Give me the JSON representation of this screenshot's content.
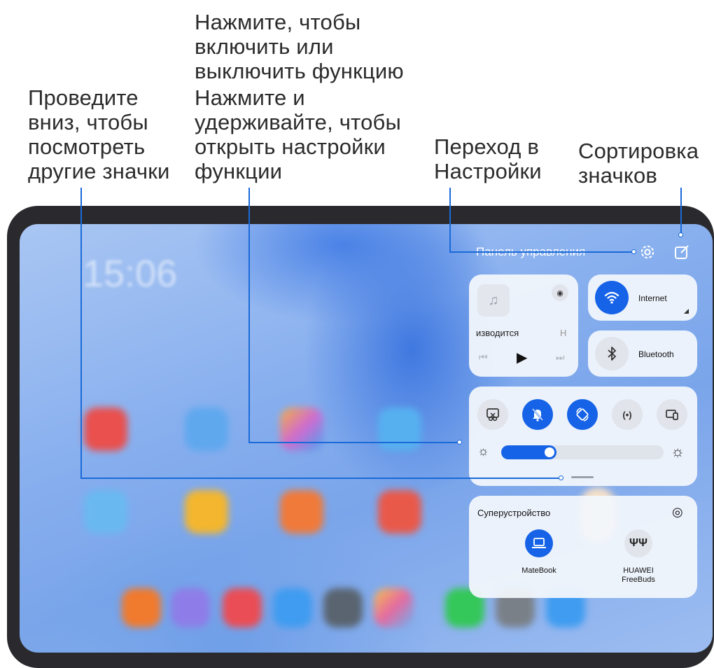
{
  "callouts": {
    "swipe": "Проведите\nвниз, чтобы\nпосмотреть\nдругие значки",
    "tap": "Нажмите, чтобы\nвключить или\nвыключить функцию",
    "hold": "Нажмите и\nудерживайте, чтобы\nоткрыть настройки\nфункции",
    "settings": "Переход в\nНастройки",
    "sort": "Сортировка\nзначков"
  },
  "lockscreen": {
    "time": "15:06"
  },
  "panel": {
    "title": "Панель управления",
    "media": {
      "status": "изводится",
      "status_end": "Н"
    },
    "internet": {
      "label": "Internet"
    },
    "bluetooth": {
      "label": "Bluetooth"
    },
    "brightness": {
      "level": 0.34
    },
    "superdevice": {
      "title": "Суперустройство",
      "devices": [
        {
          "name": "MateBook"
        },
        {
          "name": "HUAWEI\nFreeBuds"
        }
      ]
    }
  },
  "colors": {
    "accent": "#1663e8",
    "leader": "#1a6ad8"
  }
}
